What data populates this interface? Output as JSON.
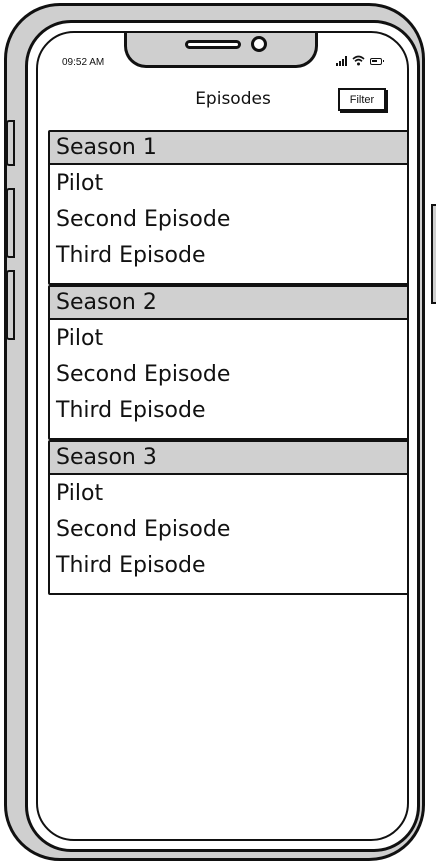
{
  "status_bar": {
    "time": "09:52 AM",
    "icons": [
      "signal-icon",
      "wifi-icon",
      "battery-icon"
    ]
  },
  "header": {
    "title": "Episodes",
    "filter_label": "Filter"
  },
  "seasons": [
    {
      "label": "Season 1",
      "episodes": [
        "Pilot",
        "Second Episode",
        "Third Episode"
      ]
    },
    {
      "label": "Season 2",
      "episodes": [
        "Pilot",
        "Second Episode",
        "Third Episode"
      ]
    },
    {
      "label": "Season 3",
      "episodes": [
        "Pilot",
        "Second Episode",
        "Third Episode"
      ]
    }
  ],
  "colors": {
    "frame": "#cfcfcf",
    "season_header_bg": "#d0d0d0",
    "ink": "#111111",
    "screen_bg": "#ffffff"
  }
}
